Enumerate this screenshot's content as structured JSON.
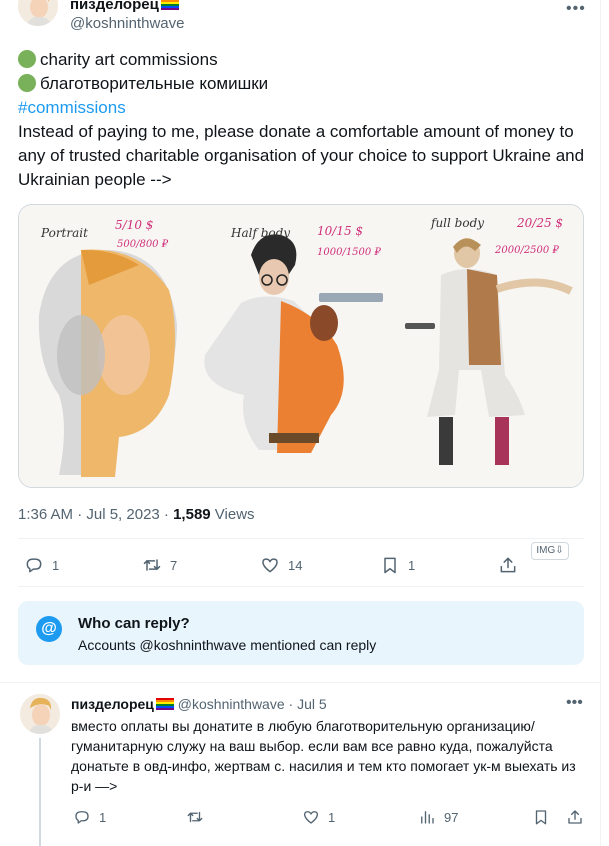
{
  "tweet": {
    "display_name": "пизделорец",
    "handle": "@koshninthwave",
    "lines": [
      "charity art commissions",
      "благотворительные комишки",
      "#commissions",
      "Instead of paying to me, please donate a comfortable amount of money to any of trusted charitable organisation of your choice to support Ukraine and Ukrainian people -->"
    ],
    "time": "1:36 AM · Jul 5, 2023 · ",
    "views_count": "1,589",
    "views_label": " Views",
    "media_labels": {
      "portrait": "Portrait",
      "portrait_price1": "5/10 $",
      "portrait_price2": "500/800 ₽",
      "half": "Half body",
      "half_price1": "10/15 $",
      "half_price2": "1000/1500 ₽",
      "full": "full body",
      "full_price1": "20/25 $",
      "full_price2": "2000/2500 ₽"
    },
    "actions": {
      "replies": "1",
      "retweets": "7",
      "likes": "14",
      "bookmarks": "1"
    },
    "img_badge": "IMG⇩"
  },
  "who_can_reply": {
    "title": "Who can reply?",
    "subtitle": "Accounts @koshninthwave mentioned can reply"
  },
  "reply": {
    "display_name": "пизделорец",
    "handle": "@koshninthwave",
    "date": "· Jul 5",
    "text": "вместо оплаты вы донатите в любую благотворительную организацию/гуманитарную служу на ваш выбор. если вам все равно куда, пожалуйста донатьте в овд-инфо, жертвам с. насилия и тем кто помогает ук-м выехать из р-и —>",
    "actions": {
      "replies": "1",
      "retweets": "",
      "likes": "1",
      "views": "97"
    }
  },
  "colors": {
    "accent": "#1d9bf0",
    "muted": "#536471",
    "reply_box_bg": "#e8f5fd"
  }
}
